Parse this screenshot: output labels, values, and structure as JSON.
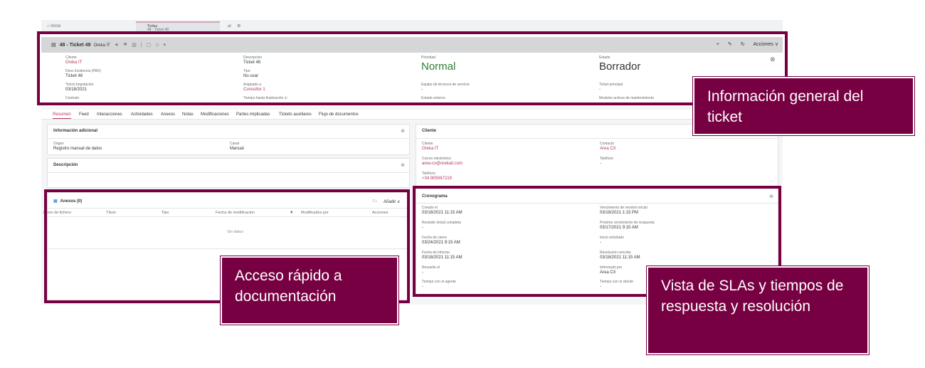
{
  "topbar": {
    "home": "Inicio",
    "tab_line1": "Todas",
    "tab_line2": "48 - Ticket 48"
  },
  "header": {
    "title": "48 - Ticket 48",
    "subtitle": "Oreka IT",
    "icons": "★ ⚑ ▥ | ▢ ◇ ▾",
    "actions": {
      "add": "+",
      "edit": "✎",
      "refresh": "↻",
      "menu": "Acciones ∨"
    },
    "fields": {
      "cliente": {
        "label": "Cliente",
        "value": "Oreka IT"
      },
      "descincidencia": {
        "label": "Desc.Incidencia (PAD)",
        "value": "Ticket 48"
      },
      "inicio": {
        "label": "*Inicio Imputación",
        "value": "03/18/2021"
      },
      "contrato": {
        "label": "Contrato",
        "value": "-"
      },
      "descripcion": {
        "label": "Descripción",
        "value": "Ticket 48"
      },
      "tipo": {
        "label": "Tipo",
        "value": "No usar"
      },
      "asignado": {
        "label": "Asignado a",
        "value": "Consultor 1"
      },
      "tiempo": {
        "label": "Tiempo hasta finalización ⊙",
        "value": "-"
      },
      "prioridad": {
        "label": "Prioridad",
        "value": "Normal"
      },
      "equipo": {
        "label": "Equipo de técnicos de servicio",
        "value": "-"
      },
      "estado_ext": {
        "label": "Estado externo",
        "value": "-"
      },
      "estado": {
        "label": "Estado",
        "value": "Borrador"
      },
      "ticket_principal": {
        "label": "Ticket principal",
        "value": "-"
      },
      "modulos": {
        "label": "Modulos activos de mantenimiento",
        "value": "-"
      }
    }
  },
  "tabs": [
    "Resumen",
    "Feed",
    "Interacciones",
    "Actividades",
    "Anexos",
    "Notas",
    "Modificaciones",
    "Partes implicadas",
    "Tickets auxiliares",
    "Flujo de documentos"
  ],
  "info_adicional": {
    "title": "Información adicional",
    "origen": {
      "label": "Origen",
      "value": "Registro manual de datos"
    },
    "canal": {
      "label": "Canal",
      "value": "Manual"
    }
  },
  "descripcion_card": {
    "title": "Descripción"
  },
  "anexos": {
    "title": "Anexos",
    "count": "(0)",
    "sort_icon": "↑↓",
    "add": "Añadir ∨",
    "columns": [
      "Icono de fichero",
      "Título",
      "Tipo",
      "Fecha de modificación",
      "Modificados por",
      "Acciones"
    ],
    "empty": "Sin datos"
  },
  "cliente_card": {
    "title": "Cliente",
    "cliente": {
      "label": "Cliente",
      "value": "Oreka IT"
    },
    "contacto": {
      "label": "Contacto",
      "value": "Area CX"
    },
    "correo": {
      "label": "Correo electrónico",
      "value": "area-cx@orekait.com"
    },
    "telefono": {
      "label": "Teléfono",
      "value": "-"
    },
    "telefono2": {
      "label": "Teléfono",
      "value": "+34 905067219"
    }
  },
  "cronograma": {
    "title": "Cronograma",
    "left": [
      {
        "label": "Creado el",
        "value": "03/18/2021 11:15 AM"
      },
      {
        "label": "Revisión inicial completa",
        "value": "-"
      },
      {
        "label": "Fecha de cierre",
        "value": "03/24/2021 9:15 AM"
      },
      {
        "label": "Fecha de informe",
        "value": "03/18/2021 11:15 AM"
      },
      {
        "label": "Resuelto el",
        "value": "-"
      },
      {
        "label": "Tiempo con el agente",
        "value": "-"
      }
    ],
    "right": [
      {
        "label": "Vencimiento de revisión inicial",
        "value": "03/18/2021 1:15 PM"
      },
      {
        "label": "Próximo vencimiento de respuesta",
        "value": "03/17/2021 9:15 AM"
      },
      {
        "label": "Inicio solicitado",
        "value": "-"
      },
      {
        "label": "Resolución vencida",
        "value": "03/18/2021 11:15 AM"
      },
      {
        "label": "Informado por",
        "value": "Area CX"
      },
      {
        "label": "Tiempo con el cliente",
        "value": "-"
      }
    ]
  },
  "callouts": {
    "general": "Información general del ticket",
    "docs": "Acceso rápido a documentación",
    "slas": "Vista de SLAs y tiempos de respuesta y resolución"
  },
  "colors": {
    "accent": "#770042",
    "link": "#b5365c",
    "normal": "#2f7d32"
  }
}
